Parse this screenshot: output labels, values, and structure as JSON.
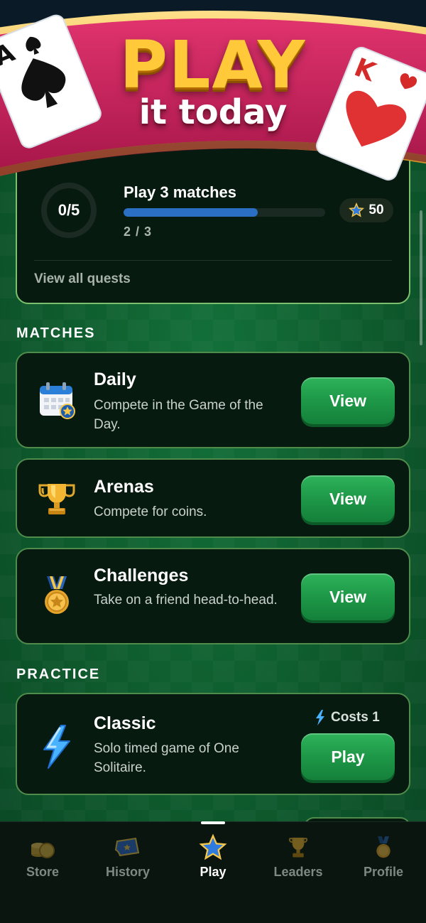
{
  "banner": {
    "title": "PLAY",
    "subtitle": "it today",
    "left_card_rank": "A",
    "right_card_rank": "K"
  },
  "quest": {
    "progress_label": "0/5",
    "name": "Play 3 matches",
    "progress": 0.667,
    "count": "2 / 3",
    "reward": "50",
    "link": "View all quests"
  },
  "matches": {
    "section": "MATCHES",
    "items": [
      {
        "title": "Daily",
        "desc": "Compete in the Game of the Day.",
        "button": "View",
        "icon": "calendar-icon"
      },
      {
        "title": "Arenas",
        "desc": "Compete for coins.",
        "button": "View",
        "icon": "trophy-icon"
      },
      {
        "title": "Challenges",
        "desc": "Take on a friend head-to-head.",
        "button": "View",
        "icon": "medal-icon"
      }
    ]
  },
  "practice": {
    "section": "PRACTICE",
    "classic": {
      "title": "Classic",
      "desc": "Solo timed game of One Solitaire.",
      "costs": "Costs 1",
      "button": "Play",
      "icon": "lightning-icon"
    }
  },
  "nav": {
    "items": [
      {
        "label": "Store",
        "icon": "coins-icon"
      },
      {
        "label": "History",
        "icon": "ticket-icon"
      },
      {
        "label": "Play",
        "icon": "star-icon",
        "active": true
      },
      {
        "label": "Leaders",
        "icon": "trophy-icon"
      },
      {
        "label": "Profile",
        "icon": "medal-icon"
      }
    ]
  },
  "colors": {
    "accent_green": "#1f9a49",
    "banner_pink": "#c4225a",
    "gold": "#ffc93a",
    "progress_blue": "#2a6fc4"
  }
}
